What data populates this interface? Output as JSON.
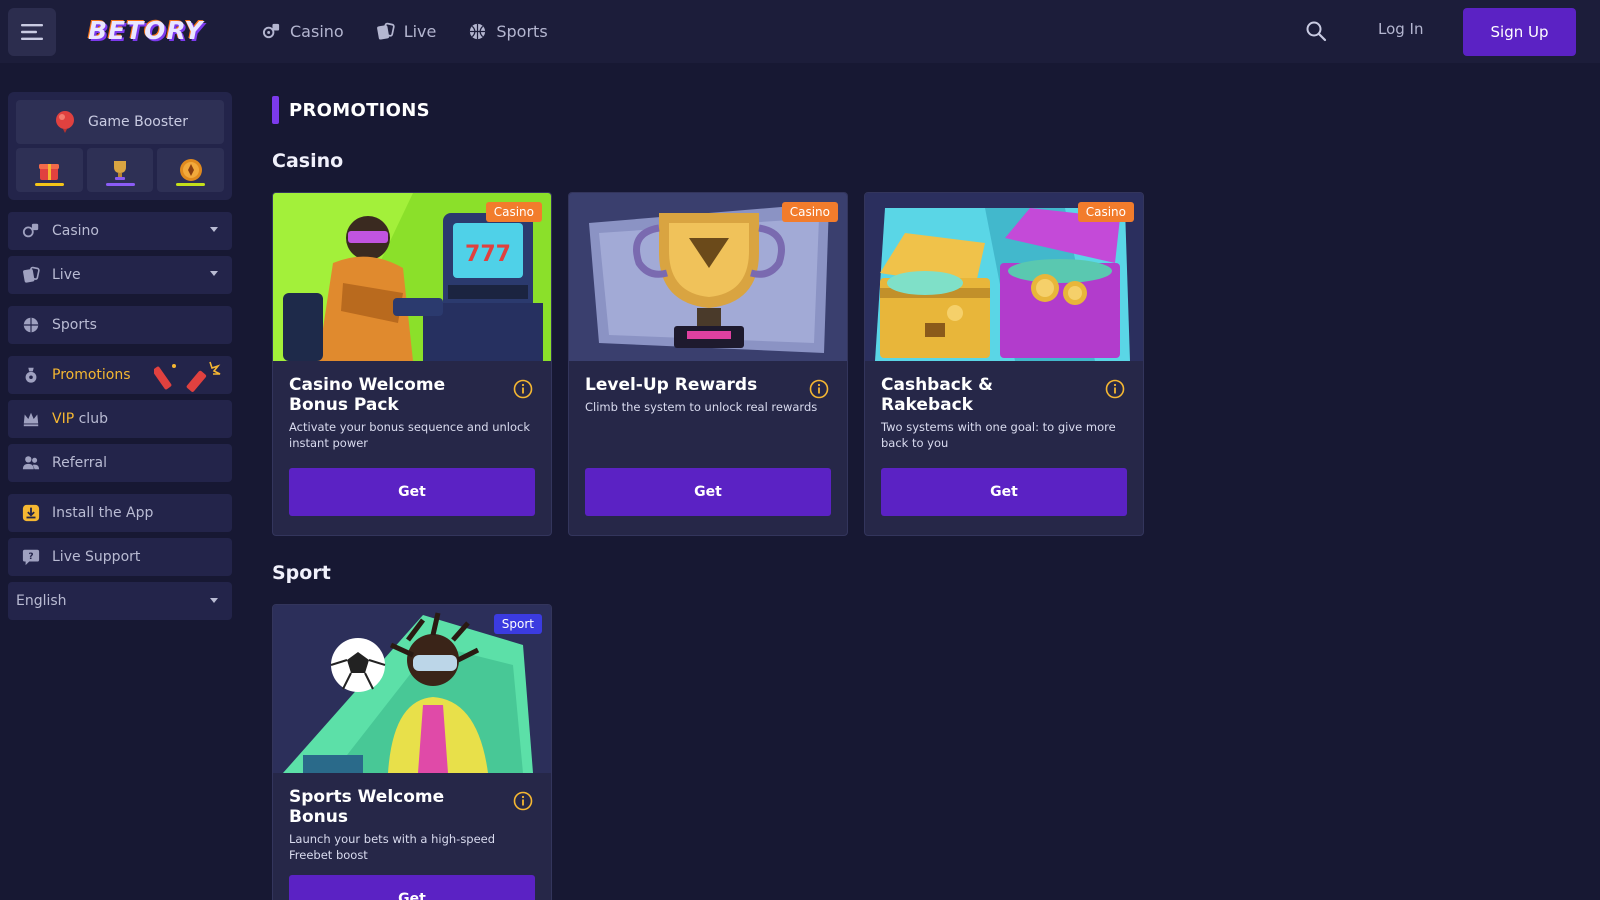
{
  "app": {
    "logo_text": "BETORY"
  },
  "topnav": {
    "items": [
      {
        "label": "Casino",
        "icon": "casino-icon"
      },
      {
        "label": "Live",
        "icon": "live-icon"
      },
      {
        "label": "Sports",
        "icon": "sports-icon"
      }
    ],
    "login_label": "Log In",
    "signup_label": "Sign Up"
  },
  "sidebar": {
    "booster_label": "Game Booster",
    "items": [
      {
        "label": "Casino",
        "icon": "casino-icon",
        "has_caret": true
      },
      {
        "label": "Live",
        "icon": "live-icon",
        "has_caret": true
      },
      {
        "label": "Sports",
        "icon": "sports-icon"
      },
      {
        "label": "Promotions",
        "icon": "promotions-icon"
      },
      {
        "label_accent": "VIP",
        "label_rest": " club",
        "icon": "crown-icon"
      },
      {
        "label": "Referral",
        "icon": "referral-icon"
      },
      {
        "label": "Install the App",
        "icon": "download-icon"
      },
      {
        "label": "Live Support",
        "icon": "support-icon"
      }
    ],
    "language": "English"
  },
  "main": {
    "page_title": "PROMOTIONS",
    "sections": [
      {
        "title": "Casino"
      },
      {
        "title": "Sport"
      }
    ],
    "cards": [
      {
        "badge": "Casino",
        "title": "Casino Welcome Bonus Pack",
        "desc": "Activate your bonus sequence and unlock instant power",
        "button": "Get"
      },
      {
        "badge": "Casino",
        "title": "Level-Up Rewards",
        "desc": "Climb the system to unlock real rewards",
        "button": "Get"
      },
      {
        "badge": "Casino",
        "title": "Cashback & Rakeback",
        "desc": "Two systems with one goal: to give more back to you",
        "button": "Get"
      },
      {
        "badge": "Sport",
        "title": "Sports Welcome Bonus",
        "desc": "Launch your bets with a high-speed Freebet boost",
        "button": "Get"
      }
    ]
  },
  "colors": {
    "background": "#171833",
    "accent_purple": "#5b22c4",
    "badge_casino": "#f27c2c",
    "badge_sport": "#3b3be0",
    "promo_gold": "#f5b732"
  }
}
